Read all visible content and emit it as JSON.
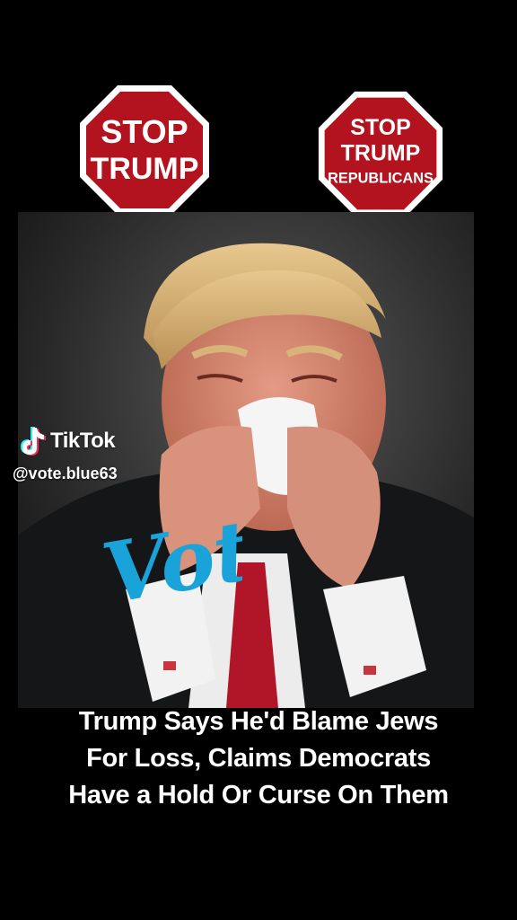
{
  "stop_sign_left": {
    "line1": "STOP",
    "line2": "TRUMP"
  },
  "stop_sign_right": {
    "line1": "STOP",
    "line2": "TRUMP",
    "line3": "REPUBLICANS"
  },
  "watermark": {
    "brand": "TikTok",
    "handle": "@vote.blue63",
    "icon": "tiktok-logo-icon"
  },
  "overlay_word": "Vote",
  "caption": {
    "line1": "Trump Says He'd Blame Jews",
    "line2": "For Loss, Claims Democrats",
    "line3": "Have a Hold Or Curse On Them"
  },
  "colors": {
    "background": "#000000",
    "stop_red": "#b3121f",
    "vote_blue": "#1aa3d9",
    "tiktok_cyan": "#25f4ee",
    "tiktok_pink": "#fe2c55"
  }
}
